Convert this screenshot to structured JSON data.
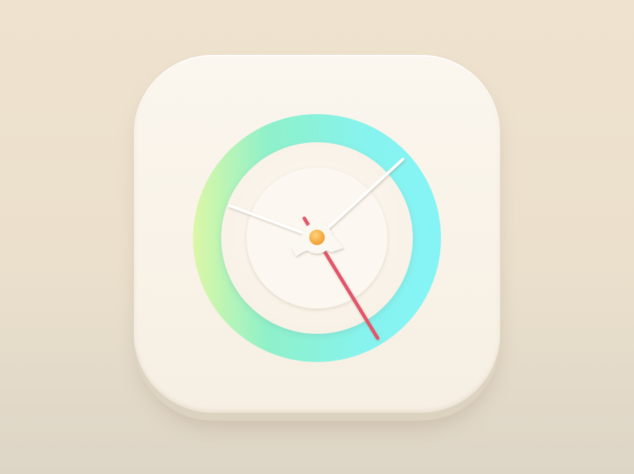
{
  "app_icon": {
    "name": "clock-app-icon",
    "colors": {
      "background_top": "#efe3cf",
      "background_bottom": "#ddd5c6",
      "icon_face": "#f8f2e8",
      "ring_gradient": [
        "#d9f7a8",
        "#8ef0cf",
        "#84f4f4"
      ],
      "second_hand": "#e2546a",
      "minute_hand": "#ffffff",
      "center_cap": "#f2a23a"
    },
    "clock": {
      "hour_hand_angle_deg": 297,
      "minute_hand_angle_deg": 45,
      "second_hand_angle_deg": 152
    }
  }
}
